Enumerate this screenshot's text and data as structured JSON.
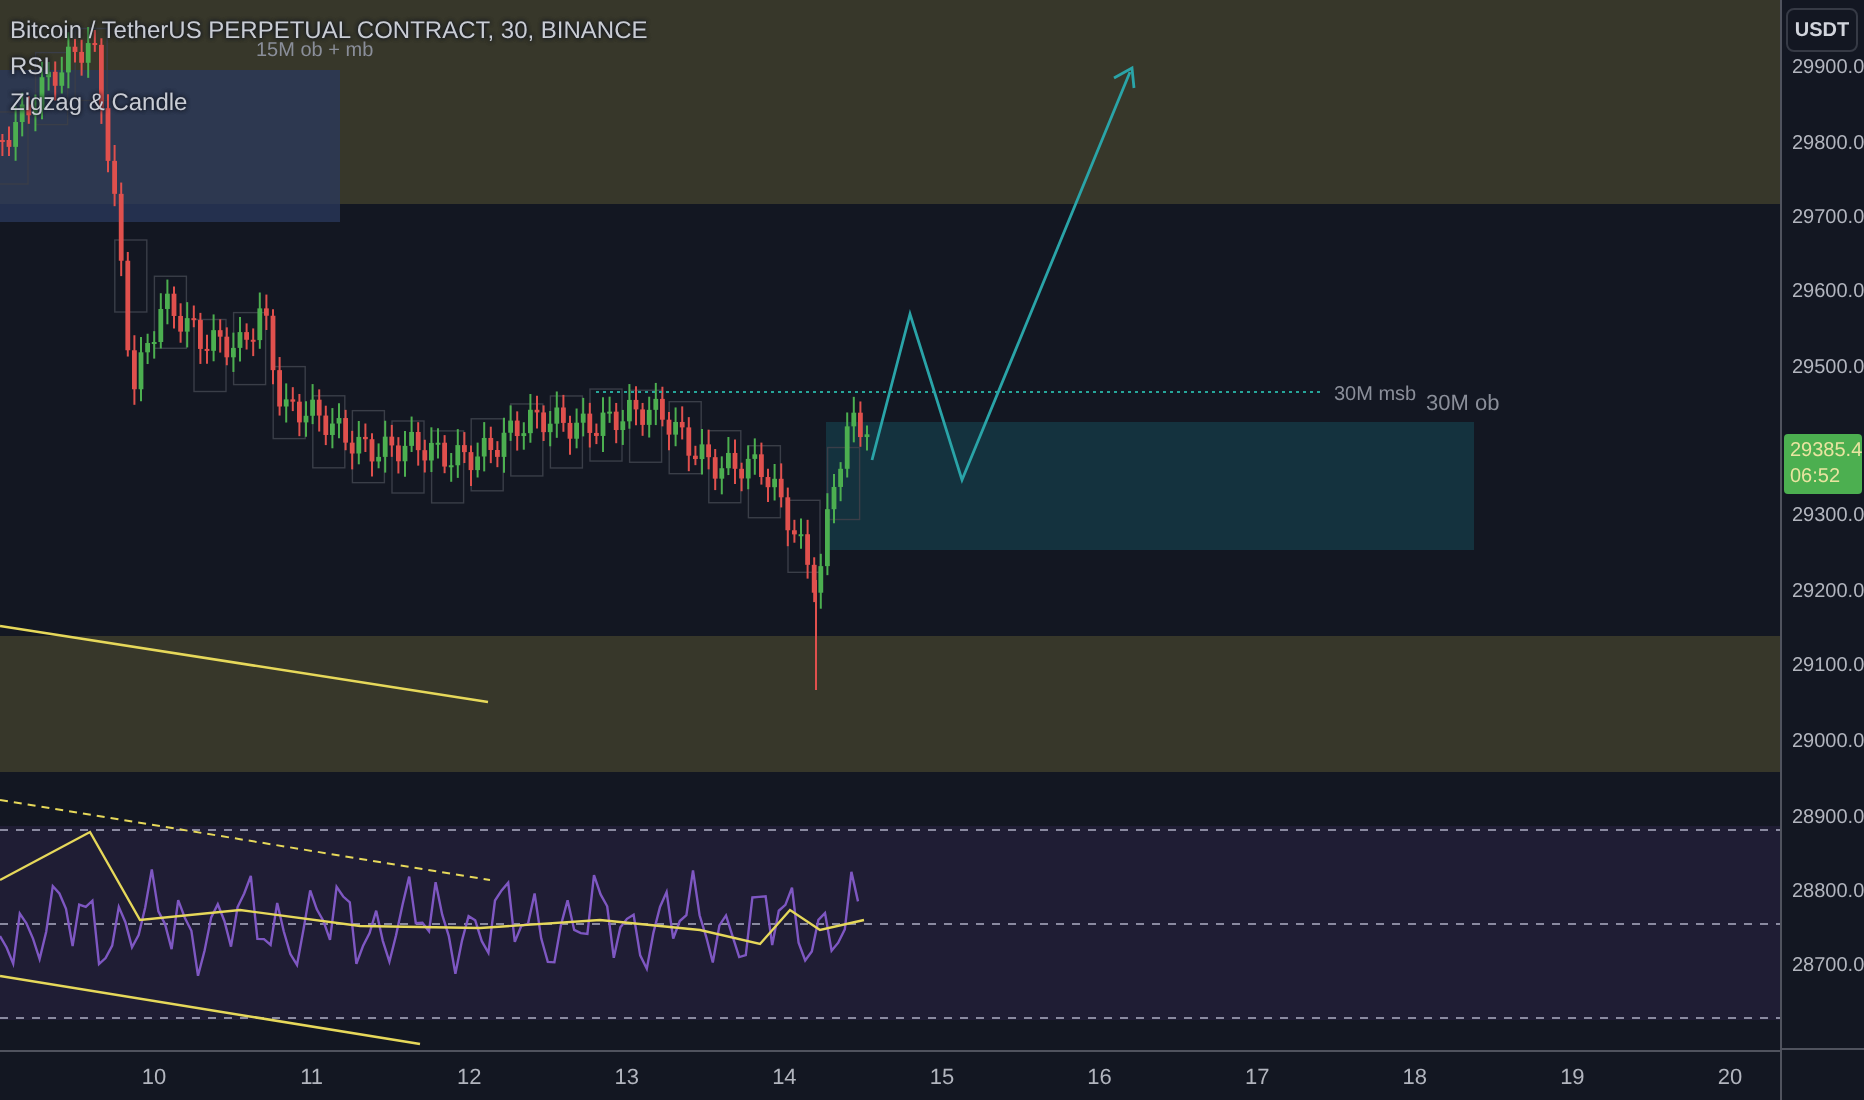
{
  "legend": [
    "Bitcoin / TetherUS PERPETUAL CONTRACT, 30, BINANCE",
    "RSI",
    "Zigzag & Candle"
  ],
  "ob_15m_label": "15M ob + mb",
  "msb_label": "30M msb",
  "ob_30m_label": "30M ob",
  "currency_button": "USDT",
  "price_axis": {
    "labels": [
      "29900.0",
      "29800.0",
      "29700.0",
      "29600.0",
      "29500.0",
      "29300.0",
      "29200.0",
      "29100.0",
      "29000.0",
      "28900.0",
      "28800.0",
      "28700.0"
    ],
    "last_price": "29385.4",
    "countdown": "06:52"
  },
  "time_axis": {
    "labels": [
      "10",
      "11",
      "12",
      "13",
      "14",
      "15",
      "16",
      "17",
      "18",
      "19",
      "20"
    ]
  }
}
